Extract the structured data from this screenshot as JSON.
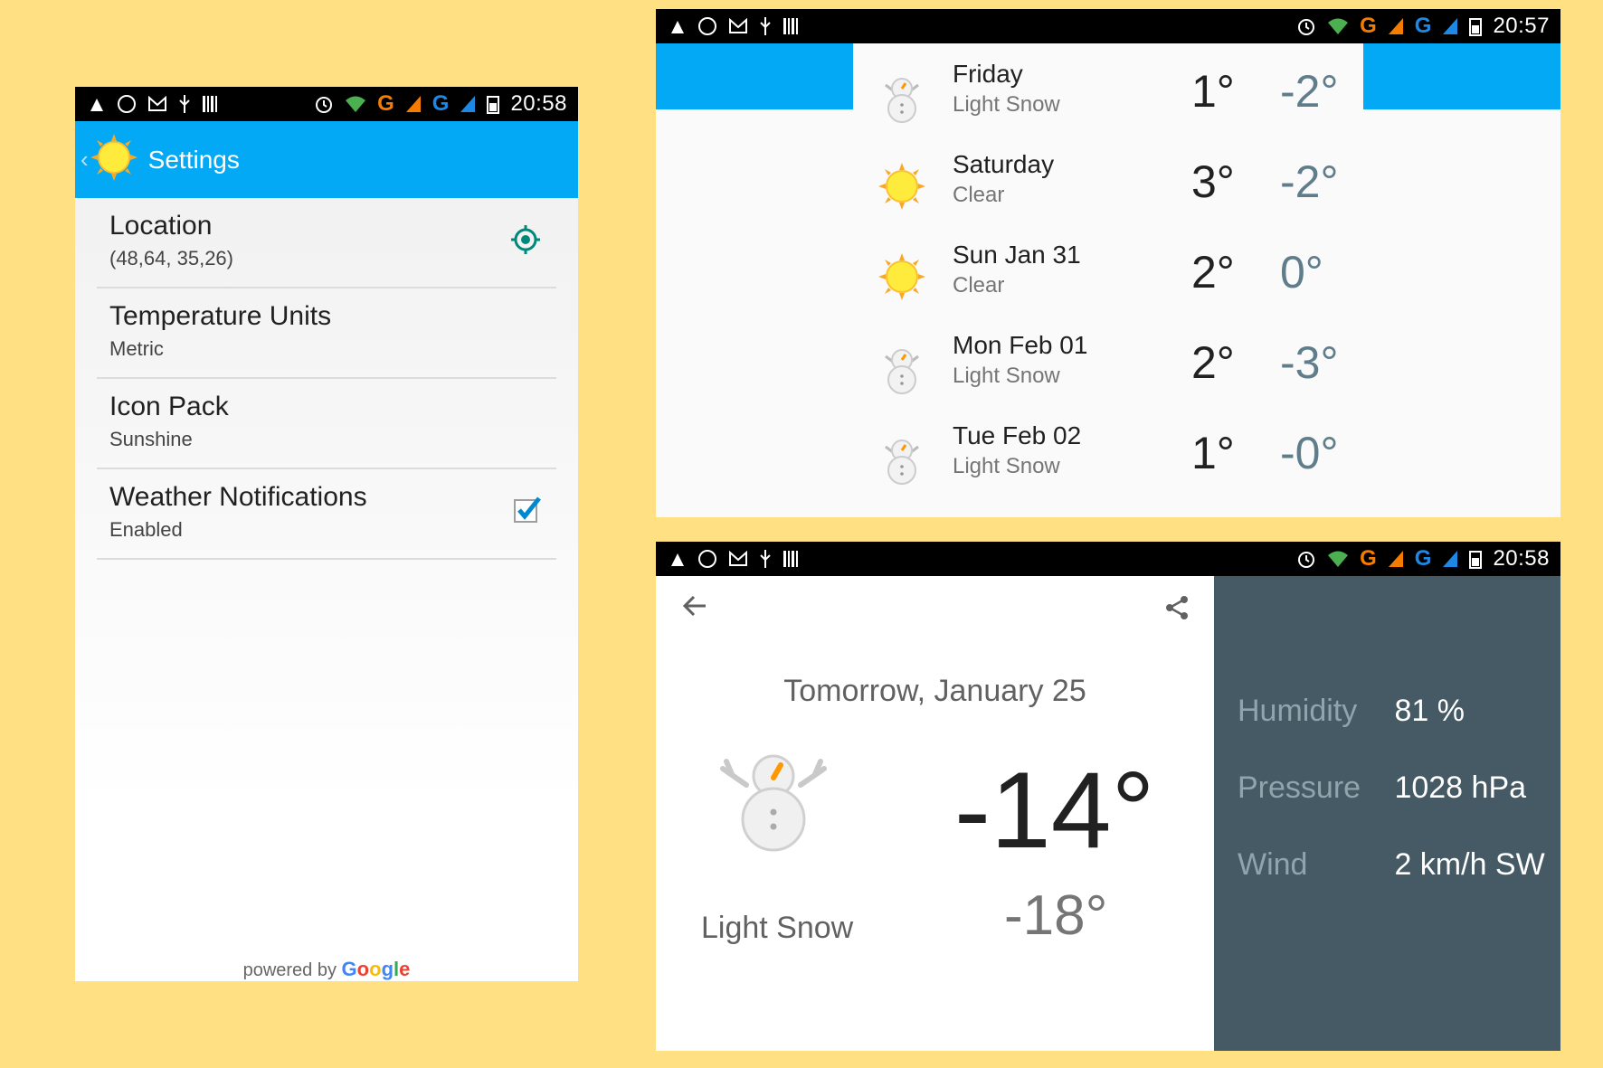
{
  "settings_screen": {
    "status": {
      "time": "20:58"
    },
    "title": "Settings",
    "prefs": [
      {
        "title": "Location",
        "summary": "(48,64, 35,26)",
        "widget": "location-target-icon"
      },
      {
        "title": "Temperature Units",
        "summary": "Metric"
      },
      {
        "title": "Icon Pack",
        "summary": "Sunshine"
      },
      {
        "title": "Weather Notifications",
        "summary": "Enabled",
        "widget": "checkbox-checked"
      }
    ],
    "footer": {
      "prefix": "powered by",
      "brand_letters": [
        "G",
        "o",
        "o",
        "g",
        "l",
        "e"
      ]
    }
  },
  "forecast_screen": {
    "status": {
      "time": "20:57"
    },
    "rows": [
      {
        "day": "Friday",
        "desc": "Light Snow",
        "hi": "1°",
        "lo": "-2°",
        "icon": "snowman-icon"
      },
      {
        "day": "Saturday",
        "desc": "Clear",
        "hi": "3°",
        "lo": "-2°",
        "icon": "sun-icon"
      },
      {
        "day": "Sun Jan 31",
        "desc": "Clear",
        "hi": "2°",
        "lo": "0°",
        "icon": "sun-icon"
      },
      {
        "day": "Mon Feb 01",
        "desc": "Light Snow",
        "hi": "2°",
        "lo": "-3°",
        "icon": "snowman-icon"
      },
      {
        "day": "Tue Feb 02",
        "desc": "Light Snow",
        "hi": "1°",
        "lo": "-0°",
        "icon": "snowman-icon"
      }
    ]
  },
  "detail_screen": {
    "status": {
      "time": "20:58"
    },
    "date": "Tomorrow, January 25",
    "high": "-14°",
    "low": "-18°",
    "desc": "Light Snow",
    "humidity_label": "Humidity",
    "humidity_value": "81 %",
    "pressure_label": "Pressure",
    "pressure_value": "1028 hPa",
    "wind_label": "Wind",
    "wind_value": "2 km/h SW"
  },
  "colors": {
    "background": "#FFE082",
    "accent": "#03A9F4",
    "detail_panel": "#455A64",
    "low_temp": "#607D8B"
  }
}
